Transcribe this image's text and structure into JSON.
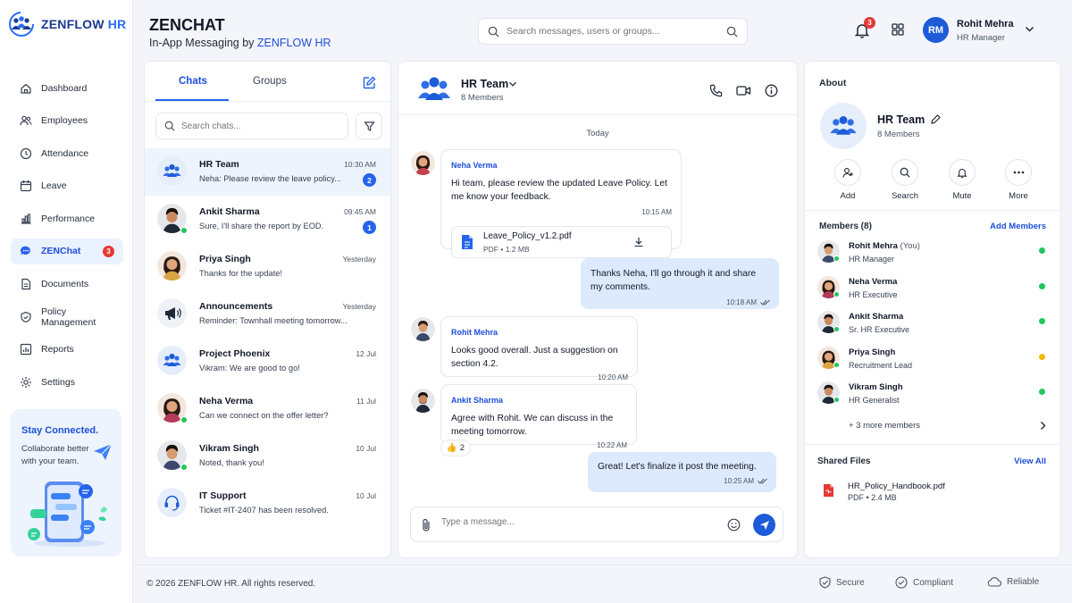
{
  "brand": {
    "name_a": "ZENFLOW",
    "name_b": " HR"
  },
  "header": {
    "title": "ZENCHAT",
    "subtitle_prefix": "In-App Messaging by ",
    "subtitle_brand": "ZENFLOW HR",
    "search_placeholder": "Search messages, users or groups...",
    "notification_count": "3",
    "user_initials": "RM",
    "user_name": "Rohit Mehra",
    "user_role": "HR Manager"
  },
  "sidebar": {
    "items": [
      {
        "label": "Dashboard",
        "icon": "home-icon"
      },
      {
        "label": "Employees",
        "icon": "users-icon"
      },
      {
        "label": "Attendance",
        "icon": "clock-icon"
      },
      {
        "label": "Leave",
        "icon": "calendar-icon"
      },
      {
        "label": "Performance",
        "icon": "chart-icon"
      },
      {
        "label": "ZENChat",
        "icon": "chat-icon",
        "badge": "3",
        "active": true
      },
      {
        "label": "Documents",
        "icon": "document-icon"
      },
      {
        "label": "Policy Management",
        "icon": "policy-icon"
      },
      {
        "label": "Reports",
        "icon": "reports-icon"
      },
      {
        "label": "Settings",
        "icon": "gear-icon"
      }
    ],
    "promo": {
      "title": "Stay Connected.",
      "text": "Collaborate better with your team."
    }
  },
  "chatlist": {
    "tabs": [
      "Chats",
      "Groups"
    ],
    "search_placeholder": "Search chats...",
    "chats": [
      {
        "name": "HR Team",
        "message": "Neha: Please review the leave policy...",
        "time": "10:30 AM",
        "badge": "2",
        "type": "group"
      },
      {
        "name": "Ankit Sharma",
        "message": "Sure, I'll share the report by EOD.",
        "time": "09:45 AM",
        "badge": "1",
        "type": "person"
      },
      {
        "name": "Priya Singh",
        "message": "Thanks for the update!",
        "time": "Yesterday",
        "badge": "",
        "type": "person"
      },
      {
        "name": "Announcements",
        "message": "Reminder: Townhall meeting tomorrow...",
        "time": "Yesterday",
        "badge": "",
        "type": "announce"
      },
      {
        "name": "Project Phoenix",
        "message": "Vikram: We are good to go!",
        "time": "12 Jul",
        "badge": "",
        "type": "group"
      },
      {
        "name": "Neha Verma",
        "message": "Can we connect on the offer letter?",
        "time": "11 Jul",
        "badge": "",
        "type": "person"
      },
      {
        "name": "Vikram Singh",
        "message": "Noted, thank you!",
        "time": "10 Jul",
        "badge": "",
        "type": "person"
      },
      {
        "name": "IT Support",
        "message": "Ticket #IT-2407 has been resolved.",
        "time": "10 Jul",
        "badge": "",
        "type": "support"
      }
    ]
  },
  "conversation": {
    "title": "HR Team",
    "members": "8 Members",
    "day": "Today",
    "messages": [
      {
        "sender": "Neha Verma",
        "text": "Hi team, please review the updated Leave Policy. Let me know your feedback.",
        "time": "10:15 AM",
        "file_name": "Leave_Policy_v1.2.pdf",
        "file_meta": "PDF • 1.2 MB"
      },
      {
        "sender": "",
        "text": "Thanks Neha, I'll go through it and share my comments.",
        "time": "10:18 AM"
      },
      {
        "sender": "Rohit Mehra",
        "text": "Looks good overall. Just a suggestion on section 4.2.",
        "time": "10:20 AM"
      },
      {
        "sender": "Ankit Sharma",
        "text": "Agree with Rohit. We can discuss in the meeting tomorrow.",
        "time": "10:22 AM",
        "reaction_count": "2"
      },
      {
        "sender": "",
        "text": "Great! Let's finalize it post the meeting.",
        "time": "10:25 AM"
      }
    ],
    "composer_placeholder": "Type a message..."
  },
  "about": {
    "title": "About",
    "group_name": "HR Team",
    "group_members": "8 Members",
    "actions": [
      "Add",
      "Search",
      "Mute",
      "More"
    ],
    "members_title": "Members (8)",
    "add_members": "Add Members",
    "members": [
      {
        "name": "Rohit Mehra",
        "suffix": " (You)",
        "role": "HR Manager",
        "status_color": "#22c55e"
      },
      {
        "name": "Neha Verma",
        "suffix": "",
        "role": "HR Executive",
        "status_color": "#22c55e"
      },
      {
        "name": "Ankit Sharma",
        "suffix": "",
        "role": "Sr. HR Executive",
        "status_color": "#22c55e"
      },
      {
        "name": "Priya Singh",
        "suffix": "",
        "role": "Recruitment Lead",
        "status_color": "#f5b800"
      },
      {
        "name": "Vikram Singh",
        "suffix": "",
        "role": "HR Generalist",
        "status_color": "#22c55e"
      }
    ],
    "more_members": "+ 3 more members",
    "shared_title": "Shared Files",
    "view_all": "View All",
    "shared_file": {
      "name": "HR_Policy_Handbook.pdf",
      "meta": "PDF • 2.4 MB"
    }
  },
  "footer": {
    "copyright": "© 2026 ZENFLOW HR. All rights reserved.",
    "items": [
      "Secure",
      "Compliant",
      "Reliable"
    ]
  },
  "colors": {
    "accent": "#2563eb",
    "danger": "#e53935",
    "online": "#22c55e",
    "away": "#f5b800"
  }
}
